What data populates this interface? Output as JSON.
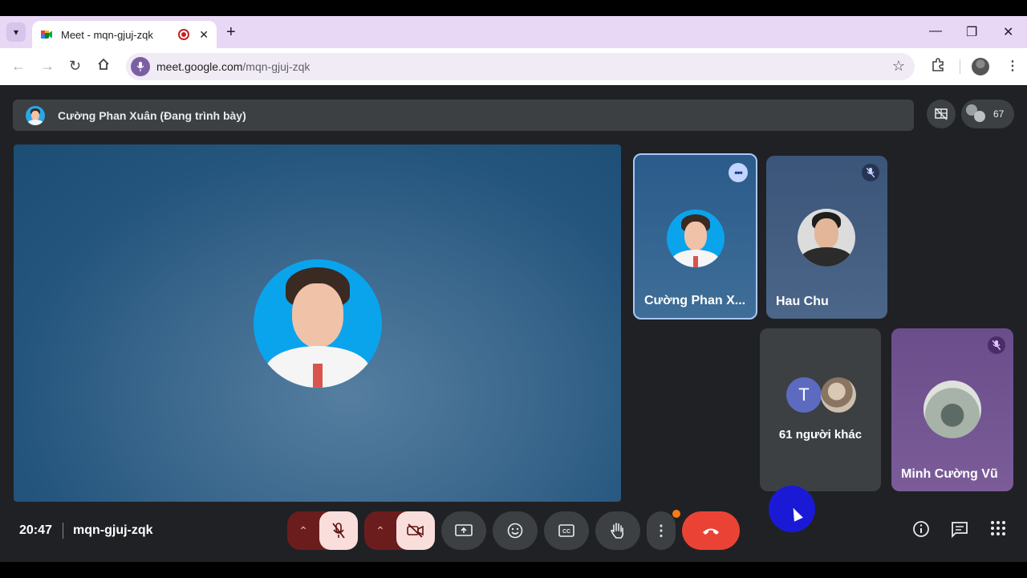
{
  "browser": {
    "tab_title": "Meet - mqn-gjuj-zqk",
    "new_tab_icon": "+",
    "close_tab_icon": "✕",
    "url_host": "meet.google.com",
    "url_path": "/mqn-gjuj-zqk",
    "window_controls": [
      "minimize-icon",
      "restore-icon",
      "close-icon"
    ]
  },
  "meeting": {
    "presenter_text": "Cường Phan Xuân (Đang trình bày)",
    "participant_count": "67",
    "clock": "20:47",
    "meeting_code": "mqn-gjuj-zqk"
  },
  "tiles": {
    "self_name": "Cường Phan X...",
    "hau_name": "Hau Chu",
    "others_initial": "T",
    "others_label": "61 người khác",
    "minh_name": "Minh Cường Vũ"
  },
  "colors": {
    "meet_bg": "#202124",
    "end_call": "#ea4335",
    "muted_control": "#f9dedc",
    "tab_strip": "#e8d7f5",
    "highlight_border": "#a8c7fa"
  }
}
